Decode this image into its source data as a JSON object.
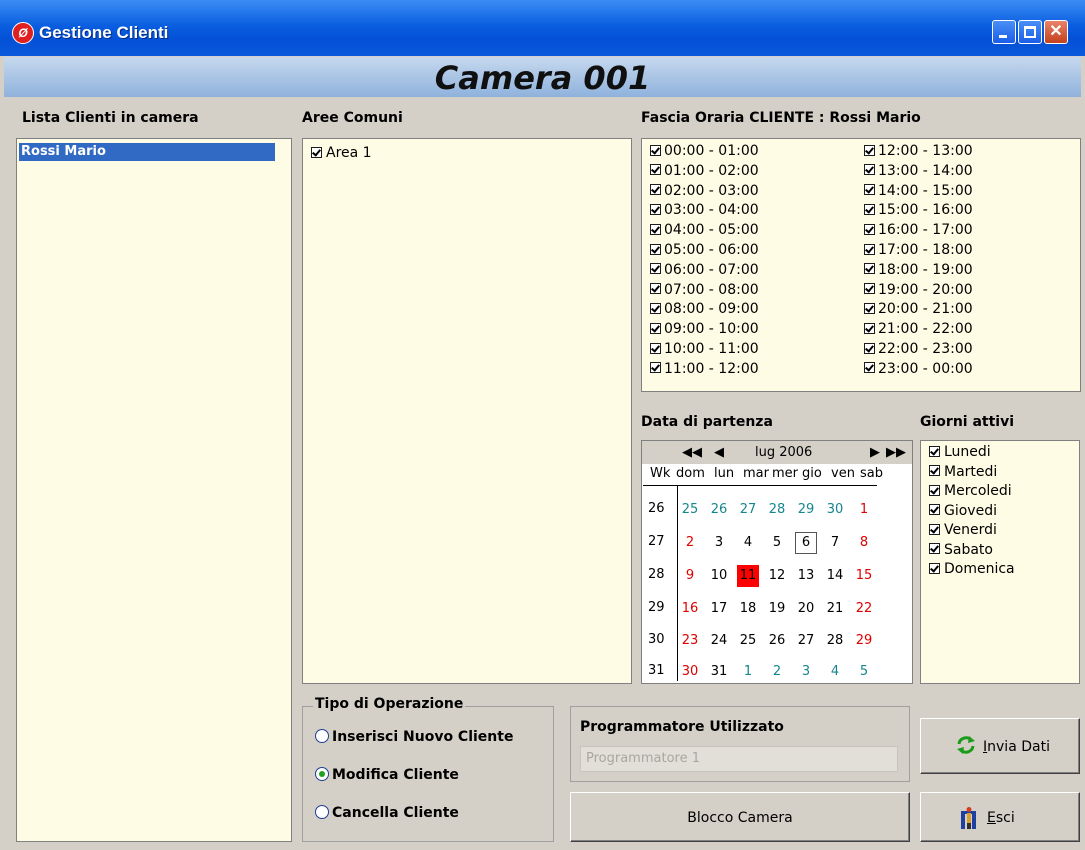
{
  "window": {
    "title": "Gestione Clienti",
    "app_icon": "app-logo-icon"
  },
  "banner": {
    "title": "Camera 001",
    "color": "#a9c3e6"
  },
  "clients": {
    "label": "Lista Clienti in camera",
    "items": [
      "Rossi Mario"
    ],
    "selected": "Rossi Mario"
  },
  "areas": {
    "label": "Aree Comuni",
    "items": [
      {
        "label": "Area 1",
        "checked": true
      }
    ]
  },
  "time_slots": {
    "label": "Fascia Oraria CLIENTE : Rossi Mario",
    "left": [
      "00:00 - 01:00",
      "01:00 - 02:00",
      "02:00 - 03:00",
      "03:00 - 04:00",
      "04:00 - 05:00",
      "05:00 - 06:00",
      "06:00 - 07:00",
      "07:00 - 08:00",
      "08:00 - 09:00",
      "09:00 - 10:00",
      "10:00 - 11:00",
      "11:00 - 12:00"
    ],
    "right": [
      "12:00 - 13:00",
      "13:00 - 14:00",
      "14:00 - 15:00",
      "15:00 - 16:00",
      "16:00 - 17:00",
      "17:00 - 18:00",
      "18:00 - 19:00",
      "19:00 - 20:00",
      "20:00 - 21:00",
      "21:00 - 22:00",
      "22:00 - 23:00",
      "23:00 - 00:00"
    ],
    "all_checked": true
  },
  "calendar": {
    "label": "Data di partenza",
    "month": "lug 2006",
    "dow": [
      "Wk",
      "dom",
      "lun",
      "mar",
      "mer",
      "gio",
      "ven",
      "sab"
    ],
    "weeks": [
      "26",
      "27",
      "28",
      "29",
      "30",
      "31"
    ],
    "rows": [
      [
        "25",
        "26",
        "27",
        "28",
        "29",
        "30",
        "1"
      ],
      [
        "2",
        "3",
        "4",
        "5",
        "6",
        "7",
        "8"
      ],
      [
        "9",
        "10",
        "11",
        "12",
        "13",
        "14",
        "15"
      ],
      [
        "16",
        "17",
        "18",
        "19",
        "20",
        "21",
        "22"
      ],
      [
        "23",
        "24",
        "25",
        "26",
        "27",
        "28",
        "29"
      ],
      [
        "30",
        "31",
        "1",
        "2",
        "3",
        "4",
        "5"
      ]
    ],
    "selected": "11",
    "today": "6",
    "colors": {
      "outside_month": "#16868c",
      "sunday": "#e00000",
      "selected_bg": "#ff0000"
    }
  },
  "days": {
    "label": "Giorni attivi",
    "items": [
      "Lunedi",
      "Martedi",
      "Mercoledi",
      "Giovedi",
      "Venerdi",
      "Sabato",
      "Domenica"
    ]
  },
  "operation": {
    "label": "Tipo di Operazione",
    "options": [
      "Inserisci Nuovo Cliente",
      "Modifica Cliente",
      "Cancella Cliente"
    ],
    "selected": "Modifica Cliente"
  },
  "programmer": {
    "label": "Programmatore Utilizzato",
    "value": "Programmatore 1"
  },
  "buttons": {
    "block": "Blocco Camera",
    "send": "Invia Dati",
    "send_key": "I",
    "send_rest": "nvia Dati",
    "exit_key": "E",
    "exit_rest": "sci"
  }
}
